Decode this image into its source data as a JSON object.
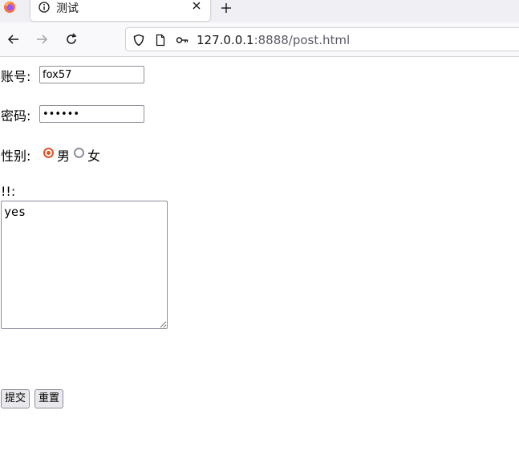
{
  "browser": {
    "tab_title": "测试",
    "url_host": "127.0.0.1",
    "url_rest": ":8888/post.html"
  },
  "form": {
    "account_label": "账号:",
    "account_value": "fox57",
    "password_label": "密码:",
    "password_value": "123456",
    "gender_label": "性别:",
    "gender_options": [
      {
        "label": "男",
        "checked": true
      },
      {
        "label": "女",
        "checked": false
      }
    ],
    "comment_label": "!!:",
    "comment_value": "yes",
    "submit_label": "提交",
    "reset_label": "重置"
  },
  "colors": {
    "accent": "#e0532b"
  }
}
